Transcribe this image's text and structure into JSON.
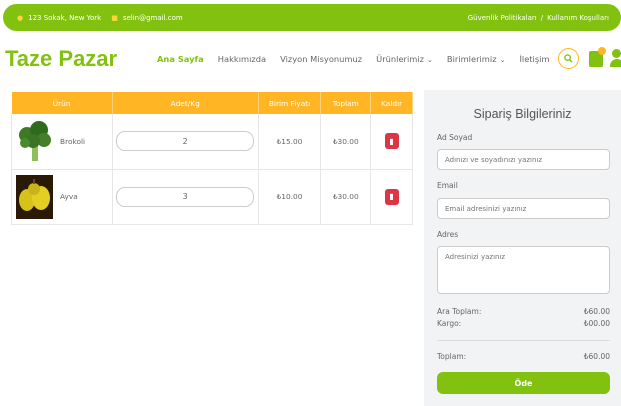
{
  "topbar": {
    "address": "123 Sokak, New York",
    "email": "selin@gmail.com",
    "links": [
      "Güvenlik Politikaları",
      "/",
      "Kullanım Koşulları"
    ]
  },
  "header": {
    "logo": "Taze Pazar",
    "nav": [
      {
        "label": "Ana Sayfa",
        "active": true,
        "dropdown": false
      },
      {
        "label": "Hakkımızda",
        "active": false,
        "dropdown": false
      },
      {
        "label": "Vizyon Misyonumuz",
        "active": false,
        "dropdown": false
      },
      {
        "label": "Ürünlerimiz",
        "active": false,
        "dropdown": true
      },
      {
        "label": "Birimlerimiz",
        "active": false,
        "dropdown": true
      },
      {
        "label": "İletişim",
        "active": false,
        "dropdown": false
      }
    ]
  },
  "cart": {
    "headers": {
      "product": "Ürün",
      "qty": "Adet/Kg",
      "unit_price": "Birim Fiyatı",
      "total": "Toplam",
      "remove": "Kaldır"
    },
    "rows": [
      {
        "name": "Brokoli",
        "qty": "2",
        "unit_price": "₺15.00",
        "total": "₺30.00"
      },
      {
        "name": "Ayva",
        "qty": "3",
        "unit_price": "₺10.00",
        "total": "₺30.00"
      }
    ]
  },
  "order": {
    "title": "Sipariş Bilgileriniz",
    "name_label": "Ad Soyad",
    "name_placeholder": "Adınızı ve soyadınızı yazınız",
    "email_label": "Email",
    "email_placeholder": "Email adresinizi yazınız",
    "address_label": "Adres",
    "address_placeholder": "Adresinizi yazınız",
    "subtotal_label": "Ara Toplam:",
    "subtotal_value": "₺60.00",
    "shipping_label": "Kargo:",
    "shipping_value": "₺00.00",
    "total_label": "Toplam:",
    "total_value": "₺60.00",
    "pay_label": "Öde"
  },
  "colors": {
    "primary": "#82c10f",
    "accent": "#ffb524",
    "danger": "#dc3545"
  },
  "icons": [
    "location-pin-icon",
    "envelope-icon",
    "search-icon",
    "shopping-bag-icon",
    "user-icon",
    "trash-icon"
  ]
}
